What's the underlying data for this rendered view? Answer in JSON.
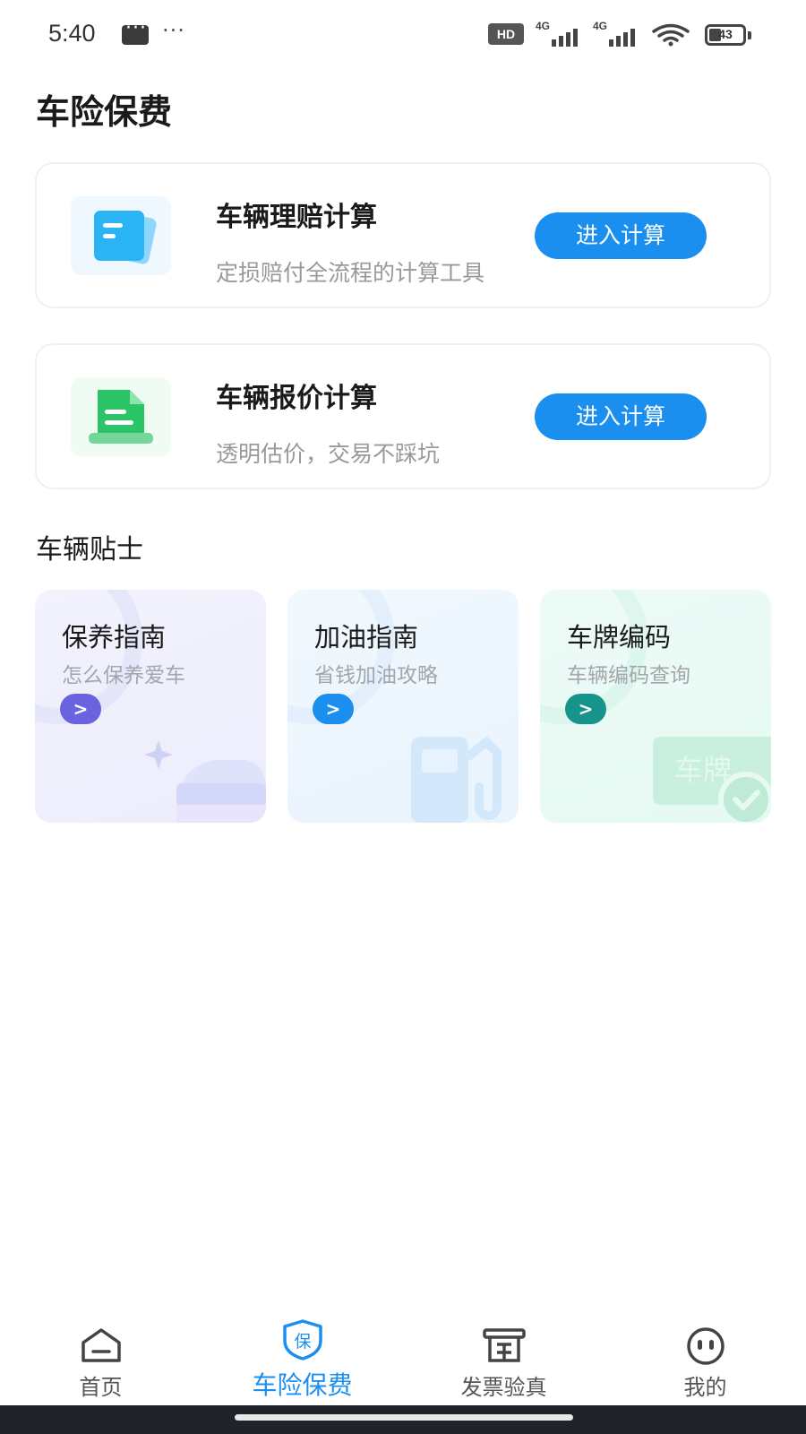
{
  "status_bar": {
    "time": "5:40",
    "hd_badge": "HD",
    "signal_1": "4G",
    "signal_2": "4G",
    "battery": "43"
  },
  "page": {
    "title": "车险保费"
  },
  "tools": [
    {
      "title": "车辆理赔计算",
      "subtitle": "定损赔付全流程的计算工具",
      "button": "进入计算",
      "icon": "document-icon",
      "color": "#2bb4f5"
    },
    {
      "title": "车辆报价计算",
      "subtitle": "透明估价，交易不踩坑",
      "button": "进入计算",
      "icon": "file-icon",
      "color": "#2bc567"
    }
  ],
  "tips": {
    "section_title": "车辆贴士",
    "items": [
      {
        "title": "保养指南",
        "subtitle": "怎么保养爱车",
        "arrow": ">",
        "accent": "#6a63e0",
        "bg": "#f1f1fd"
      },
      {
        "title": "加油指南",
        "subtitle": "省钱加油攻略",
        "arrow": ">",
        "accent": "#1a8ff0",
        "bg": "#eef6fd"
      },
      {
        "title": "车牌编码",
        "subtitle": "车辆编码查询",
        "arrow": ">",
        "accent": "#16938a",
        "bg": "#ebfaf6"
      }
    ]
  },
  "bottom_nav": {
    "items": [
      {
        "label": "首页",
        "icon": "home-icon"
      },
      {
        "label": "车险保费",
        "icon": "shield-icon",
        "active": true,
        "icon_text": "保"
      },
      {
        "label": "发票验真",
        "icon": "invoice-icon"
      },
      {
        "label": "我的",
        "icon": "profile-icon"
      }
    ]
  }
}
